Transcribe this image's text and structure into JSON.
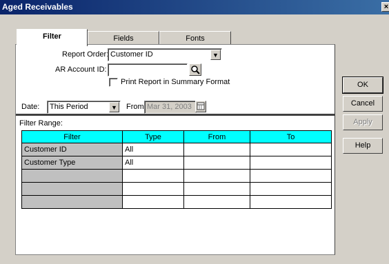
{
  "window": {
    "title": "Aged Receivables",
    "close_label": "×"
  },
  "tabs": [
    {
      "label": "Filter",
      "active": true
    },
    {
      "label": "Fields",
      "active": false
    },
    {
      "label": "Fonts",
      "active": false
    }
  ],
  "report_order": {
    "label": "Report Order:",
    "value": "Customer ID"
  },
  "ar_account": {
    "label": "AR Account ID:",
    "value": ""
  },
  "summary_checkbox": {
    "label": "Print Report in Summary Format",
    "checked": false
  },
  "date": {
    "label": "Date:",
    "value": "This Period"
  },
  "from": {
    "label": "From:",
    "value": "Mar 31, 2003"
  },
  "filter_range": {
    "label": "Filter Range:",
    "columns": [
      "Filter",
      "Type",
      "From",
      "To"
    ],
    "rows": [
      [
        "Customer ID",
        "All",
        "",
        ""
      ],
      [
        "Customer Type",
        "All",
        "",
        ""
      ],
      [
        "",
        "",
        "",
        ""
      ],
      [
        "",
        "",
        "",
        ""
      ],
      [
        "",
        "",
        "",
        ""
      ]
    ]
  },
  "buttons": {
    "ok": "OK",
    "cancel": "Cancel",
    "apply": "Apply",
    "help": "Help"
  }
}
